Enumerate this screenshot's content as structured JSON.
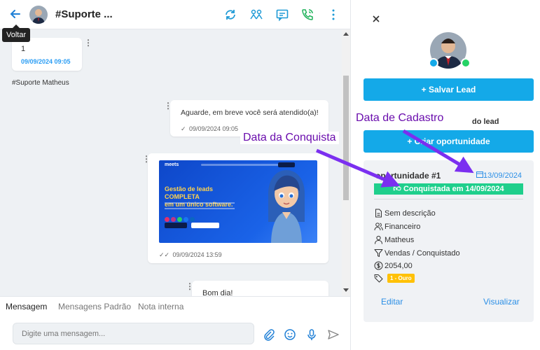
{
  "header": {
    "back_tooltip": "Voltar",
    "contact_title": "#Suporte ..."
  },
  "chat": {
    "messages": [
      {
        "text": "1",
        "time": "09/09/2024 09:05",
        "direction": "incoming"
      },
      {
        "text": "Aguarde, em breve você será atendido(a)!",
        "time": "09/09/2024 09:05",
        "direction": "outgoing"
      },
      {
        "text": "",
        "time": "09/09/2024 13:59",
        "direction": "outgoing",
        "kind": "image"
      },
      {
        "text": "Bom dia!",
        "time": "",
        "direction": "outgoing"
      }
    ],
    "sender_label": "#Suporte Matheus",
    "preview": {
      "logo": "meets",
      "heading_part1": "Gestão de leads COMPLETA",
      "heading_part2": "em um único software."
    }
  },
  "input": {
    "tabs": [
      "Mensagem",
      "Mensagens Padrão",
      "Nota interna"
    ],
    "active_tab": "Mensagem",
    "placeholder": "Digite uma mensagem..."
  },
  "lead_panel": {
    "save_button": "Salvar Lead",
    "section_title": "do lead",
    "create_opportunity_button": "Criar oportunidade",
    "opportunity": {
      "title": "oportunidade #1",
      "created_date": "13/09/2024",
      "won_label": "Conquistada em 14/09/2024",
      "description": "Sem descrição",
      "department": "Financeiro",
      "owner": "Matheus",
      "pipeline": "Vendas / Conquistado",
      "value": "2054,00",
      "tag": "1 - Ouro"
    },
    "edit_link": "Editar",
    "view_link": "Visualizar"
  },
  "annotations": {
    "created_label": "Data de Cadastro",
    "won_label": "Data da Conquista"
  },
  "colors": {
    "primary": "#14a9e8",
    "success": "#1fcf8c",
    "annotation": "#6a0dad",
    "tag": "#ffc107"
  }
}
